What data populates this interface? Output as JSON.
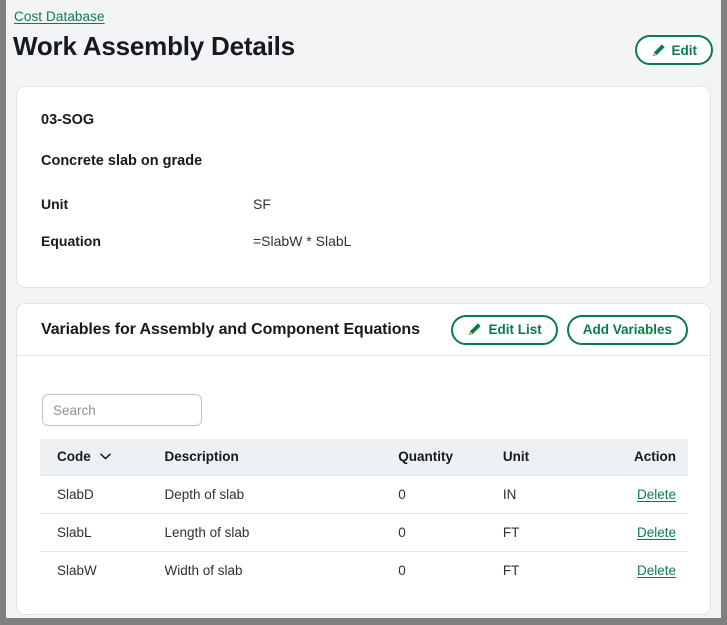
{
  "window": {
    "page_background": "#f2f4f5",
    "frame_color": "#808080"
  },
  "header": {
    "breadcrumb": "Cost Database",
    "title": "Work Assembly Details",
    "edit_button": {
      "label": "Edit",
      "icon": "pencil-icon"
    }
  },
  "theme": {
    "accent_green": "#0a7c4a",
    "link_green": "#0b7a57",
    "text_dark": "#16191d",
    "text_body": "#2b3138",
    "card_border": "#dfe3e8",
    "table_header_bg": "#eef1f4",
    "row_divider": "#e3e7ea",
    "pencil_body": "#0a7c4a",
    "pencil_tip": "#d8c46a"
  },
  "details": {
    "code": "03-SOG",
    "description": "Concrete slab on grade",
    "fields": [
      {
        "label": "Unit",
        "value": "SF"
      },
      {
        "label": "Equation",
        "value": "=SlabW * SlabL"
      }
    ]
  },
  "variables": {
    "title": "Variables for Assembly and Component Equations",
    "edit_list_button": {
      "label": "Edit List",
      "icon": "pencil-icon"
    },
    "add_variables_button": {
      "label": "Add Variables"
    },
    "search": {
      "value": "",
      "placeholder": "Search"
    },
    "table": {
      "columns": [
        {
          "key": "code",
          "label": "Code",
          "sort_icon": "chevron-down-icon",
          "sorted": true
        },
        {
          "key": "description",
          "label": "Description"
        },
        {
          "key": "quantity",
          "label": "Quantity"
        },
        {
          "key": "unit",
          "label": "Unit"
        },
        {
          "key": "action",
          "label": "Action"
        }
      ],
      "rows": [
        {
          "code": "SlabD",
          "description": "Depth of slab",
          "quantity": "0",
          "unit": "IN",
          "action": "Delete"
        },
        {
          "code": "SlabL",
          "description": "Length of slab",
          "quantity": "0",
          "unit": "FT",
          "action": "Delete"
        },
        {
          "code": "SlabW",
          "description": "Width of slab",
          "quantity": "0",
          "unit": "FT",
          "action": "Delete"
        }
      ]
    }
  }
}
